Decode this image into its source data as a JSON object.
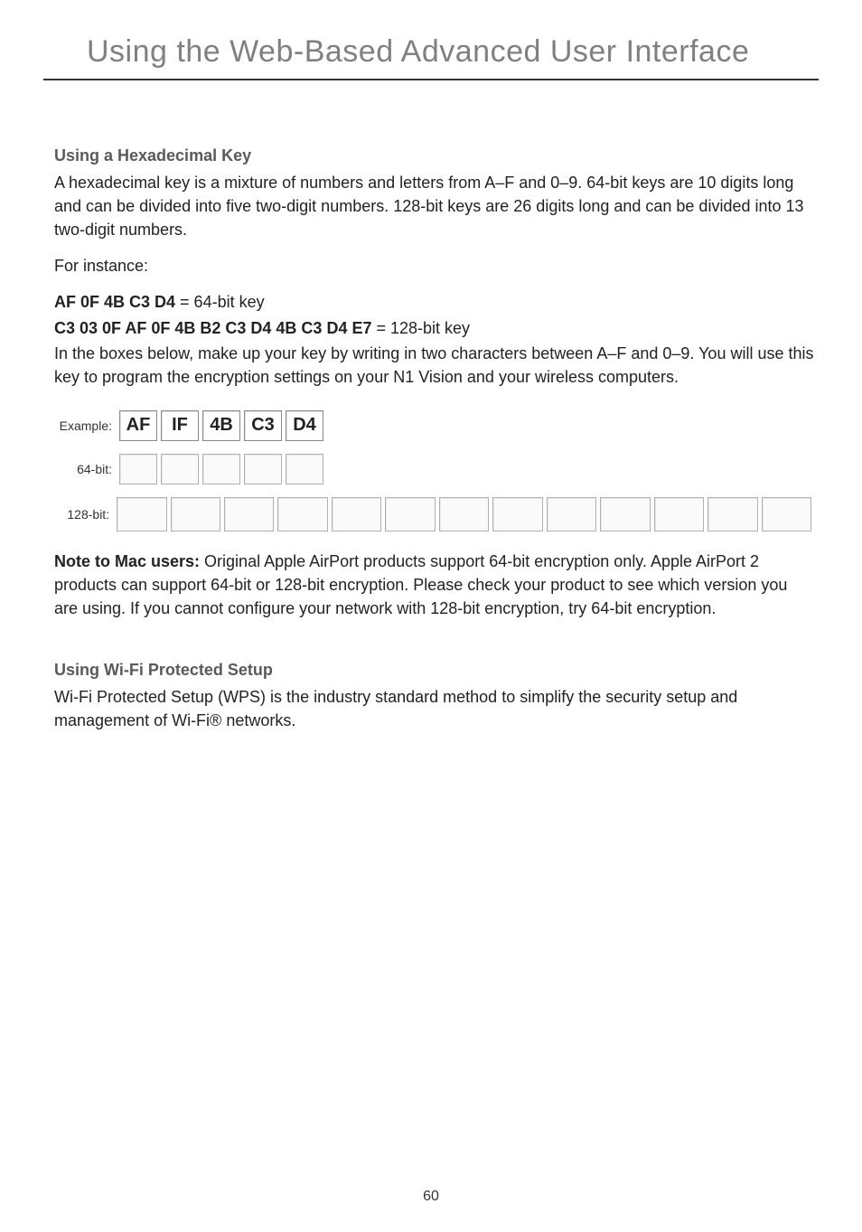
{
  "header": {
    "title": "Using the Web-Based Advanced User Interface"
  },
  "section_hex": {
    "heading": "Using a Hexadecimal Key",
    "para1": "A hexadecimal key is a mixture of numbers and letters from A–F and 0–9. 64-bit keys are 10 digits long and can be divided into five two-digit numbers. 128-bit keys are 26 digits long and can be divided into 13 two-digit numbers.",
    "para2": "For instance:",
    "line64_bold": "AF 0F 4B C3 D4",
    "line64_rest": " = 64-bit key",
    "line128_bold": "C3 03 0F AF 0F 4B B2 C3 D4 4B C3 D4 E7",
    "line128_rest": " = 128-bit key",
    "para3": "In the boxes below, make up your key by writing in two characters between A–F and 0–9. You will use this key to program the encryption settings on your N1 Vision and your wireless computers."
  },
  "boxes": {
    "example_label": "Example:",
    "example_values": [
      "AF",
      "IF",
      "4B",
      "C3",
      "D4"
    ],
    "label_64": "64-bit:",
    "count_64": 5,
    "label_128": "128-bit:",
    "count_128": 13
  },
  "note_mac": {
    "prefix": "Note to Mac users:",
    "text": " Original Apple AirPort products support 64-bit encryption only. Apple AirPort 2 products can support 64-bit or 128-bit encryption. Please check your product to see which version you are using. If you cannot configure your network with 128-bit encryption, try 64-bit encryption."
  },
  "section_wps": {
    "heading": "Using Wi-Fi Protected Setup",
    "para": "Wi-Fi Protected Setup (WPS) is the industry standard method to simplify the security setup and management of Wi-Fi® networks."
  },
  "page_number": "60"
}
